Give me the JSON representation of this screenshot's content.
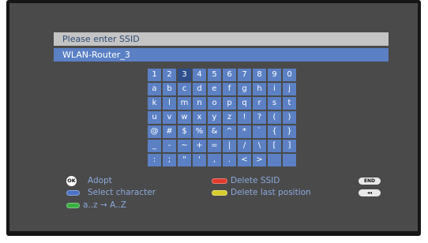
{
  "dialog": {
    "title": "Please enter SSID",
    "input_value": "WLAN-Router_3"
  },
  "keyboard": {
    "rows": [
      [
        "1",
        "2",
        "3",
        "4",
        "5",
        "6",
        "7",
        "8",
        "9",
        "0"
      ],
      [
        "a",
        "b",
        "c",
        "d",
        "e",
        "f",
        "g",
        "h",
        "i",
        "j"
      ],
      [
        "k",
        "l",
        "m",
        "n",
        "o",
        "p",
        "q",
        "r",
        "s",
        "t"
      ],
      [
        "u",
        "v",
        "w",
        "x",
        "y",
        "z",
        "!",
        "?",
        "(",
        ")"
      ],
      [
        "@",
        "#",
        "$",
        "%",
        "&",
        "^",
        "*",
        "`",
        "{",
        "}"
      ],
      [
        "_",
        "-",
        "~",
        "+",
        "=",
        "|",
        "/",
        "\\",
        "[",
        "]"
      ],
      [
        ":",
        ";",
        "\"",
        "'",
        ",",
        ".",
        "<",
        ">",
        "",
        ""
      ]
    ],
    "selected_key": "3"
  },
  "legend": {
    "ok_icon_label": "OK",
    "adopt": "Adopt",
    "select_character": "Select character",
    "case_toggle": "a..z → A..Z",
    "delete_ssid": "Delete SSID",
    "delete_last_position": "Delete last position",
    "end_label": "END",
    "rewind_label": "◂◂"
  },
  "colors": {
    "key_fill": "#5b80c4",
    "key_selected": "#2e4f8c",
    "blue_button": "#4a72c8",
    "green_button": "#38b040",
    "red_button": "#e03a2a",
    "yellow_button": "#d6cc2a"
  }
}
